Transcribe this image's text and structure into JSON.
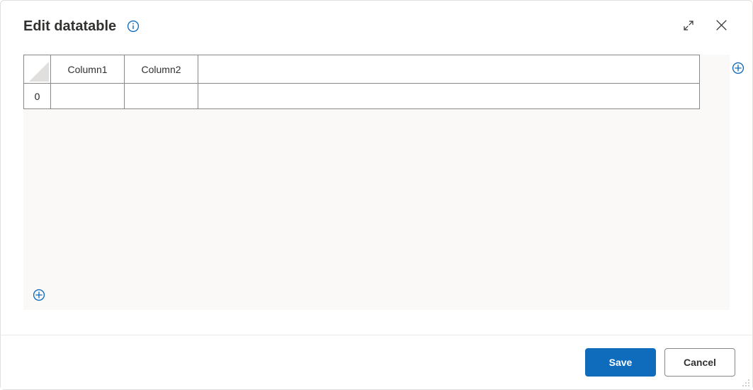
{
  "dialog": {
    "title": "Edit datatable",
    "save_label": "Save",
    "cancel_label": "Cancel"
  },
  "table": {
    "columns": [
      "Column1",
      "Column2"
    ],
    "rows": [
      {
        "index": "0",
        "cells": [
          "",
          ""
        ]
      }
    ]
  },
  "colors": {
    "accent": "#0f6cbd",
    "row_header_selected": "#8bb7f0"
  }
}
